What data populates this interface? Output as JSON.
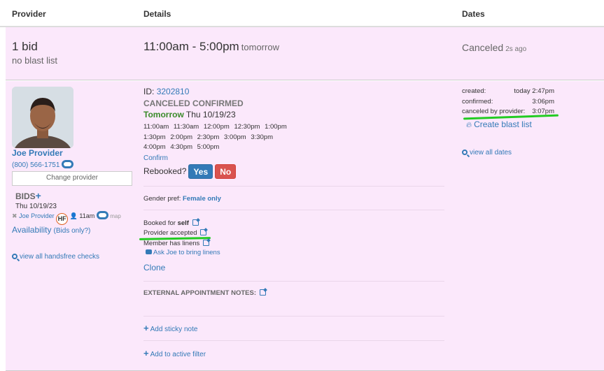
{
  "header": {
    "provider": "Provider",
    "details": "Details",
    "dates": "Dates"
  },
  "summary": {
    "bids": "1 bid",
    "blast": "no blast list",
    "time_range": "11:00am - 5:00pm",
    "time_suffix": "tomorrow",
    "status": "Canceled",
    "status_ago": "2s ago"
  },
  "provider": {
    "name": "Joe Provider",
    "phone": "(800) 566-1751",
    "change_placeholder": "Change provider",
    "bids_label": "BIDS",
    "bid_date": "Thu 10/19/23",
    "bid_provider": "Joe Provider",
    "hf": "HF",
    "bid_time": "11am",
    "map": "map",
    "availability": "Availability",
    "bids_only": "(Bids only?)",
    "handsfree": "view all handsfree checks"
  },
  "details": {
    "id_label": "ID:",
    "id_value": "3202810",
    "status": "CANCELED CONFIRMED",
    "day_label": "Tomorrow",
    "day_date": "Thu 10/19/23",
    "times_row1": [
      "11:00am",
      "11:30am",
      "12:00pm",
      "12:30pm",
      "1:00pm"
    ],
    "times_row2": [
      "1:30pm",
      "2:00pm",
      "2:30pm",
      "3:00pm",
      "3:30pm"
    ],
    "times_row3": [
      "4:00pm",
      "4:30pm",
      "5:00pm"
    ],
    "confirm": "Confirm",
    "rebooked": "Rebooked?",
    "yes": "Yes",
    "no": "No",
    "gender_label": "Gender pref:",
    "gender_value": "Female only",
    "booked_for": "Booked for",
    "booked_for_value": "self",
    "provider_accepted": "Provider accepted",
    "member_linens": "Member has linens",
    "ask_linens": "Ask Joe to bring linens",
    "clone": "Clone",
    "external_notes": "EXTERNAL APPOINTMENT NOTES:",
    "sticky": "Add sticky note",
    "active_filter": "Add to active filter"
  },
  "dates": {
    "created_label": "created:",
    "created_value": "today 2:47pm",
    "confirmed_label": "confirmed:",
    "confirmed_value": "3:06pm",
    "canceled_label": "canceled by provider:",
    "canceled_value": "3:07pm",
    "create_blast": "Create blast list",
    "view_dates": "view all dates"
  },
  "colors": {
    "row_bg": "#fbe8fb",
    "link": "#337ab7",
    "yes": "#337ab7",
    "no": "#d9534f",
    "annotation": "#22cc22"
  }
}
